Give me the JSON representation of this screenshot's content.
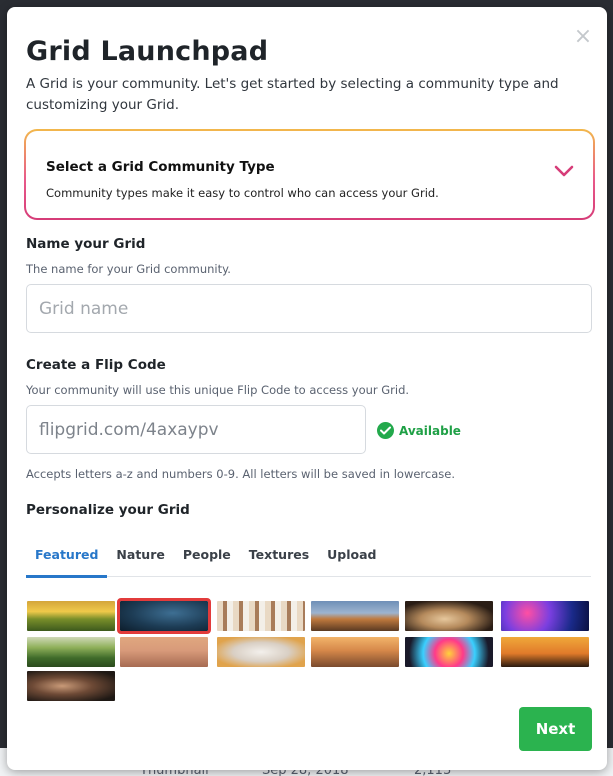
{
  "dialog": {
    "title": "Grid Launchpad",
    "intro": "A Grid is your community. Let's get started by selecting a community type and customizing your Grid.",
    "close_icon": "×"
  },
  "community_type": {
    "title": "Select a Grid Community Type",
    "description": "Community types make it easy to control who can access your Grid."
  },
  "name_section": {
    "heading": "Name your Grid",
    "subtitle": "The name for your Grid community.",
    "placeholder": "Grid name",
    "value": ""
  },
  "flip_code": {
    "heading": "Create a Flip Code",
    "subtitle": "Your community will use this unique Flip Code to access your Grid.",
    "value": "flipgrid.com/4axaypv",
    "status": "Available",
    "hint": "Accepts letters a-z and numbers 0-9. All letters will be saved in lowercase."
  },
  "personalize": {
    "heading": "Personalize your Grid",
    "tabs": [
      "Featured",
      "Nature",
      "People",
      "Textures",
      "Upload"
    ],
    "active_tab": 0,
    "selected_image": 1,
    "images": [
      "sunset-hills",
      "elephants",
      "crowd-raised-arms",
      "city-lanterns",
      "pug-dog",
      "colorful-bokeh",
      "tropical-hillside",
      "drone-sky",
      "cat-glasses",
      "city-skyline-sunset",
      "color-powder",
      "jumping-silhouettes",
      "woman-portrait"
    ]
  },
  "actions": {
    "next_label": "Next"
  },
  "background_peek": {
    "left": "Thumbnail",
    "mid": "Sep 28, 2018",
    "right": "2,113"
  },
  "colors": {
    "accent": "#2777c9",
    "success": "#2bb34f",
    "chevron": "#d63c78",
    "selection": "#e23b3b"
  }
}
